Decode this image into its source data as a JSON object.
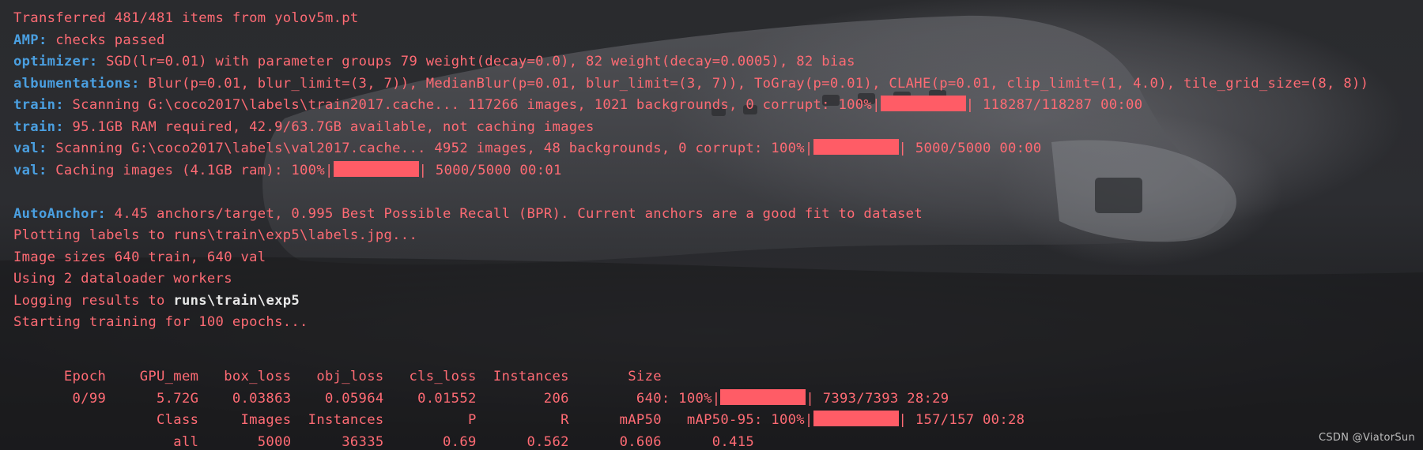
{
  "console": {
    "line1": "Transferred 481/481 items from yolov5m.pt",
    "amp_key": "AMP:",
    "amp_text": " checks passed",
    "optimizer_key": "optimizer:",
    "optimizer_text": " SGD(lr=0.01) with parameter groups 79 weight(decay=0.0), 82 weight(decay=0.0005), 82 bias",
    "albumentations_key": "albumentations:",
    "albumentations_text": " Blur(p=0.01, blur_limit=(3, 7)), MedianBlur(p=0.01, blur_limit=(3, 7)), ToGray(p=0.01), CLAHE(p=0.01, clip_limit=(1, 4.0), tile_grid_size=(8, 8))",
    "train1_key": "train:",
    "train1_text": " Scanning G:\\coco2017\\labels\\train2017.cache... 117266 images, 1021 backgrounds, 0 corrupt: 100%|",
    "train1_tail": "| 118287/118287 00:00",
    "train1_progress": 1.0,
    "train2_key": "train:",
    "train2_text": " 95.1GB RAM required, 42.9/63.7GB available, not caching images",
    "val1_key": "val:",
    "val1_text": " Scanning G:\\coco2017\\labels\\val2017.cache... 4952 images, 48 backgrounds, 0 corrupt: 100%|",
    "val1_tail": "| 5000/5000 00:00",
    "val1_progress": 1.0,
    "val2_key": "val:",
    "val2_text": " Caching images (4.1GB ram): 100%|",
    "val2_tail": "| 5000/5000 00:01",
    "val2_progress": 1.0,
    "autoanchor_key": "AutoAnchor:",
    "autoanchor_text": " 4.45 anchors/target, 0.995 Best Possible Recall (BPR). Current anchors are a good fit to dataset",
    "plotting": "Plotting labels to runs\\train\\exp5\\labels.jpg...",
    "image_sizes": "Image sizes 640 train, 640 val",
    "workers": "Using 2 dataloader workers",
    "logging_prefix": "Logging results to ",
    "logging_path": "runs\\train\\exp5",
    "starting": "Starting training for 100 epochs...",
    "epoch_header": "      Epoch    GPU_mem   box_loss   obj_loss   cls_loss  Instances       Size",
    "epoch_row": "       0/99      5.72G    0.03863    0.05964    0.01552        206        640: 100%|",
    "epoch_tail": "| 7393/7393 28:29",
    "epoch_progress": 1.0,
    "val_header": "                 Class     Images  Instances          P          R      mAP50   mAP50-95: 100%|",
    "val_header_tail": "| 157/157 00:28",
    "val_progress": 1.0,
    "val_row": "                   all       5000      36335       0.69      0.562      0.606      0.415"
  },
  "watermark": "CSDN @ViatorSun",
  "colors": {
    "text": "#ff6b74",
    "key": "#4a9fe0",
    "bar": "#ff5c66",
    "background": "#1f2023"
  }
}
